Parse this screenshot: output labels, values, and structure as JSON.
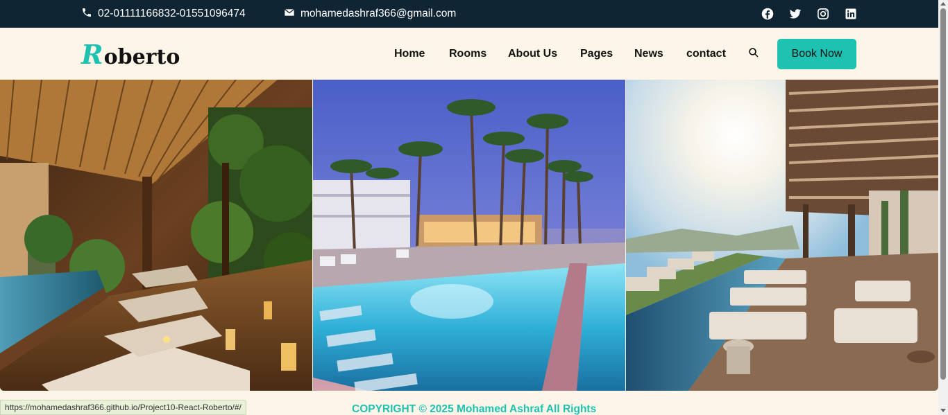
{
  "topbar": {
    "phone": "02-01111166832-01551096474",
    "email": "mohamedashraf366@gmail.com",
    "social": [
      "facebook-icon",
      "twitter-icon",
      "instagram-icon",
      "linkedin-icon"
    ]
  },
  "nav": {
    "logo_first": "R",
    "logo_rest": "oberto",
    "items": [
      "Home",
      "Rooms",
      "About Us",
      "Pages",
      "News",
      "contact"
    ],
    "book_label": "Book Now"
  },
  "gallery": {
    "images": [
      "spa-lounge-image",
      "pool-palms-image",
      "rooftop-pool-image"
    ]
  },
  "footer": {
    "copyright": "COPYRIGHT © 2025 Mohamed Ashraf All Rights"
  },
  "status_url": "https://mohamedashraf366.github.io/Project10-React-Roberto/#/",
  "colors": {
    "accent": "#1fc1b1",
    "topbar": "#0f2533",
    "background": "#fdf6e8"
  }
}
